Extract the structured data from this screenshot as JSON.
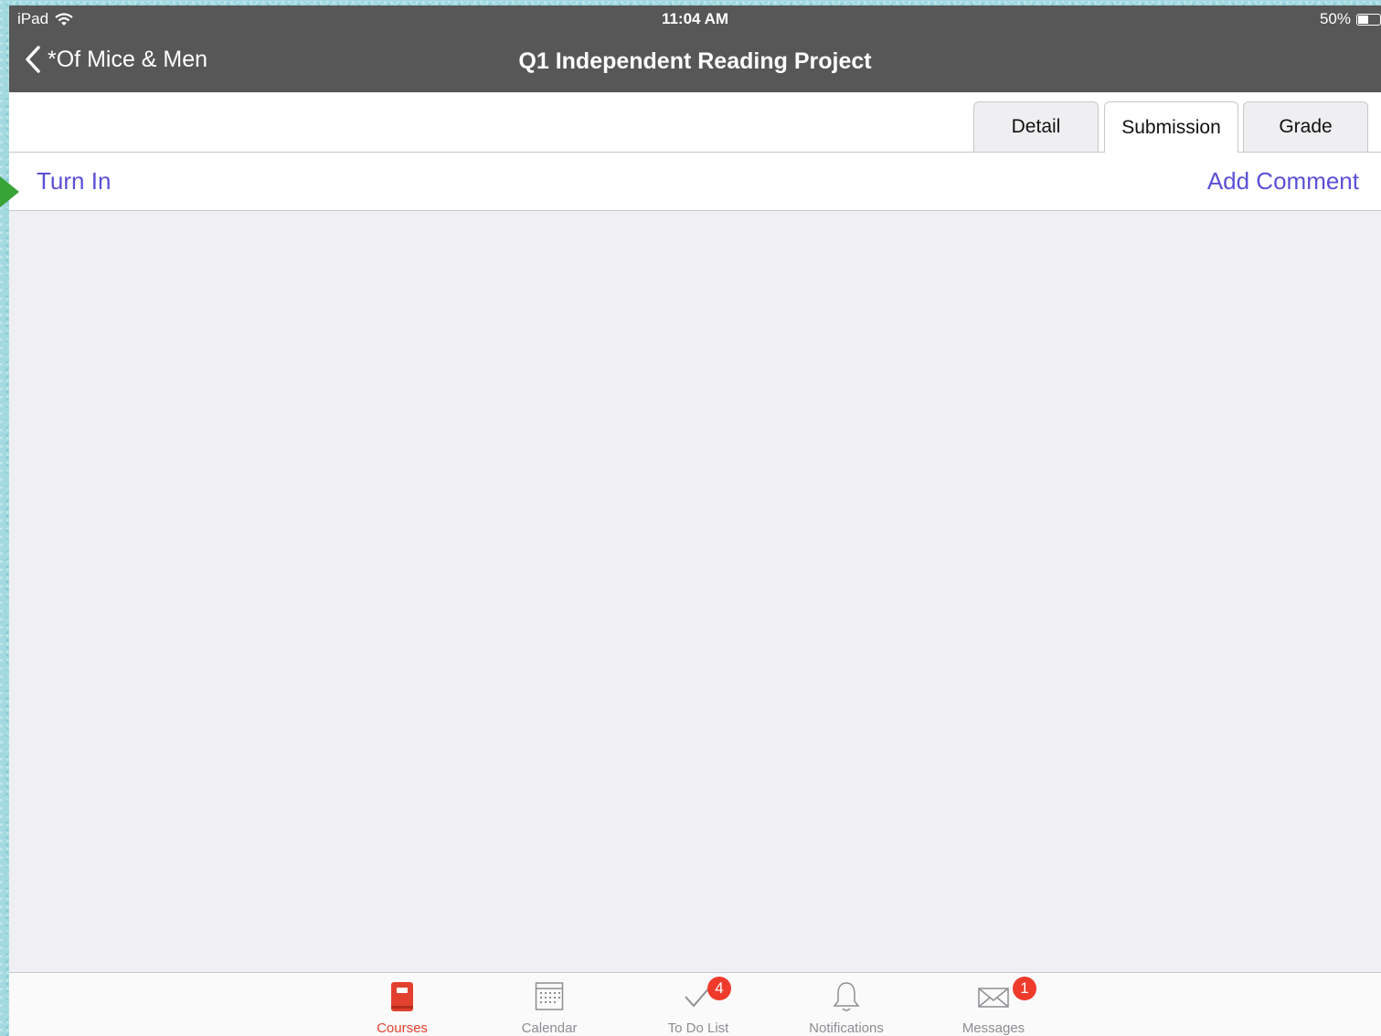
{
  "status_bar": {
    "device": "iPad",
    "time": "11:04 AM",
    "battery": "50%",
    "battery_level": 0.5
  },
  "nav": {
    "back_label": "*Of Mice & Men",
    "title": "Q1 Independent Reading Project"
  },
  "segments": [
    {
      "label": "Detail",
      "active": false
    },
    {
      "label": "Submission",
      "active": true
    },
    {
      "label": "Grade",
      "active": false
    }
  ],
  "actions": {
    "turn_in": "Turn In",
    "add_comment": "Add Comment"
  },
  "colors": {
    "nav_bar": "#575757",
    "accent": "#5b50d6",
    "active_tab": "#e2412f",
    "badge": "#ee3b2c",
    "marker": "#37a437"
  },
  "tab_bar": [
    {
      "label": "Courses",
      "icon": "book-icon",
      "active": true
    },
    {
      "label": "Calendar",
      "icon": "calendar-icon",
      "active": false
    },
    {
      "label": "To Do List",
      "icon": "checkmark-icon",
      "badge": "4",
      "active": false
    },
    {
      "label": "Notifications",
      "icon": "bell-icon",
      "active": false
    },
    {
      "label": "Messages",
      "icon": "envelope-icon",
      "badge": "1",
      "active": false
    }
  ]
}
